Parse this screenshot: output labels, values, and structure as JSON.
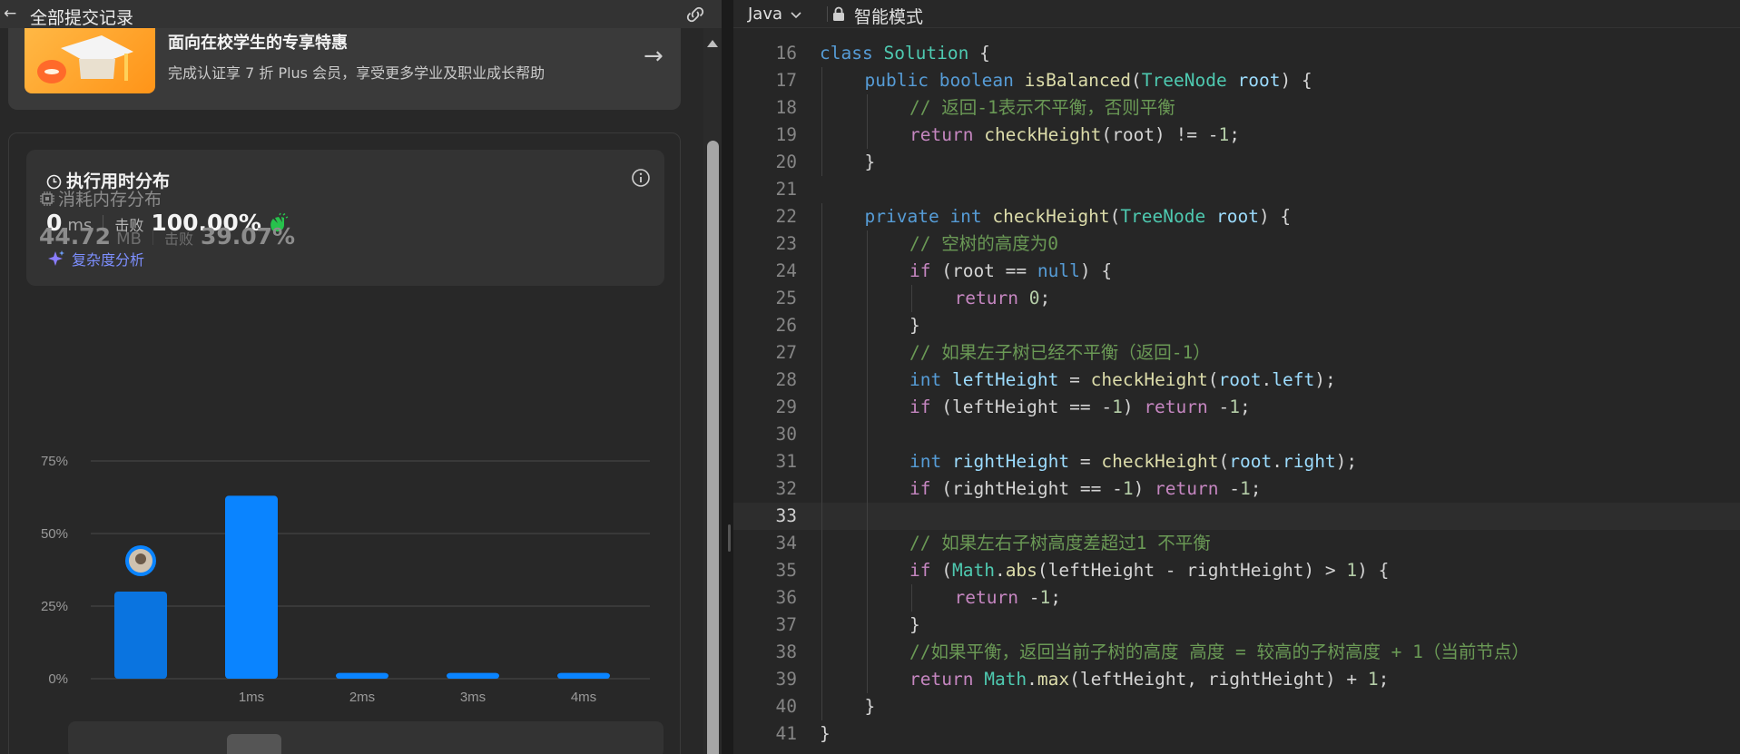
{
  "left_header": {
    "title": "全部提交记录"
  },
  "promo": {
    "title": "面向在校学生的专享特惠",
    "subtitle": "完成认证享 7 折 Plus 会员，享受更多学业及职业成长帮助"
  },
  "runtime": {
    "title": "执行用时分布",
    "value": "0",
    "unit": "ms",
    "beat_label": "击败",
    "beat_value": "100.00%",
    "complexity_link": "复杂度分析"
  },
  "memory": {
    "title": "消耗内存分布",
    "value": "44.72",
    "unit": "MB",
    "beat_label": "击败",
    "beat_value": "39.07%"
  },
  "chart_data": {
    "type": "bar",
    "categories": [
      "",
      "1ms",
      "2ms",
      "3ms",
      "4ms"
    ],
    "values": [
      30,
      63,
      2,
      2,
      2
    ],
    "ylim": [
      0,
      75
    ],
    "yticks": [
      "0%",
      "25%",
      "50%",
      "75%"
    ],
    "highlight_index": 0,
    "bar_color": "#0a84ff",
    "grid": true
  },
  "editor": {
    "language": "Java",
    "mode_label": "智能模式",
    "active_line": 33,
    "lines": [
      {
        "n": 16,
        "indent": 0,
        "tokens": [
          [
            "kw",
            "class"
          ],
          [
            "pl",
            " "
          ],
          [
            "ty",
            "Solution"
          ],
          [
            "pl",
            " {"
          ]
        ]
      },
      {
        "n": 17,
        "indent": 1,
        "tokens": [
          [
            "kw",
            "public"
          ],
          [
            "pl",
            " "
          ],
          [
            "kw",
            "boolean"
          ],
          [
            "pl",
            " "
          ],
          [
            "fn",
            "isBalanced"
          ],
          [
            "pl",
            "("
          ],
          [
            "ty",
            "TreeNode"
          ],
          [
            "pl",
            " "
          ],
          [
            "id",
            "root"
          ],
          [
            "pl",
            ") {"
          ]
        ]
      },
      {
        "n": 18,
        "indent": 2,
        "tokens": [
          [
            "cm",
            "// 返回-1表示不平衡，否则平衡"
          ]
        ]
      },
      {
        "n": 19,
        "indent": 2,
        "tokens": [
          [
            "kw2",
            "return"
          ],
          [
            "pl",
            " "
          ],
          [
            "fn",
            "checkHeight"
          ],
          [
            "pl",
            "(root) != -"
          ],
          [
            "num",
            "1"
          ],
          [
            "pl",
            ";"
          ]
        ]
      },
      {
        "n": 20,
        "indent": 1,
        "tokens": [
          [
            "pl",
            "}"
          ]
        ]
      },
      {
        "n": 21,
        "indent": 0,
        "tokens": []
      },
      {
        "n": 22,
        "indent": 1,
        "tokens": [
          [
            "kw",
            "private"
          ],
          [
            "pl",
            " "
          ],
          [
            "kw",
            "int"
          ],
          [
            "pl",
            " "
          ],
          [
            "fn",
            "checkHeight"
          ],
          [
            "pl",
            "("
          ],
          [
            "ty",
            "TreeNode"
          ],
          [
            "pl",
            " "
          ],
          [
            "id",
            "root"
          ],
          [
            "pl",
            ") {"
          ]
        ]
      },
      {
        "n": 23,
        "indent": 2,
        "tokens": [
          [
            "cm",
            "// 空树的高度为0"
          ]
        ]
      },
      {
        "n": 24,
        "indent": 2,
        "tokens": [
          [
            "kw2",
            "if"
          ],
          [
            "pl",
            " (root == "
          ],
          [
            "kw",
            "null"
          ],
          [
            "pl",
            ") {"
          ]
        ]
      },
      {
        "n": 25,
        "indent": 3,
        "tokens": [
          [
            "kw2",
            "return"
          ],
          [
            "pl",
            " "
          ],
          [
            "num",
            "0"
          ],
          [
            "pl",
            ";"
          ]
        ]
      },
      {
        "n": 26,
        "indent": 2,
        "tokens": [
          [
            "pl",
            "}"
          ]
        ]
      },
      {
        "n": 27,
        "indent": 2,
        "tokens": [
          [
            "cm",
            "// 如果左子树已经不平衡（返回-1）"
          ]
        ]
      },
      {
        "n": 28,
        "indent": 2,
        "tokens": [
          [
            "kw",
            "int"
          ],
          [
            "pl",
            " "
          ],
          [
            "id",
            "leftHeight"
          ],
          [
            "pl",
            " = "
          ],
          [
            "fn",
            "checkHeight"
          ],
          [
            "pl",
            "("
          ],
          [
            "id",
            "root"
          ],
          [
            "pl",
            "."
          ],
          [
            "id",
            "left"
          ],
          [
            "pl",
            ");"
          ]
        ]
      },
      {
        "n": 29,
        "indent": 2,
        "tokens": [
          [
            "kw2",
            "if"
          ],
          [
            "pl",
            " (leftHeight == -"
          ],
          [
            "num",
            "1"
          ],
          [
            "pl",
            ") "
          ],
          [
            "kw2",
            "return"
          ],
          [
            "pl",
            " -"
          ],
          [
            "num",
            "1"
          ],
          [
            "pl",
            ";"
          ]
        ]
      },
      {
        "n": 30,
        "indent": 0,
        "tokens": []
      },
      {
        "n": 31,
        "indent": 2,
        "tokens": [
          [
            "kw",
            "int"
          ],
          [
            "pl",
            " "
          ],
          [
            "id",
            "rightHeight"
          ],
          [
            "pl",
            " = "
          ],
          [
            "fn",
            "checkHeight"
          ],
          [
            "pl",
            "("
          ],
          [
            "id",
            "root"
          ],
          [
            "pl",
            "."
          ],
          [
            "id",
            "right"
          ],
          [
            "pl",
            ");"
          ]
        ]
      },
      {
        "n": 32,
        "indent": 2,
        "tokens": [
          [
            "kw2",
            "if"
          ],
          [
            "pl",
            " (rightHeight == -"
          ],
          [
            "num",
            "1"
          ],
          [
            "pl",
            ") "
          ],
          [
            "kw2",
            "return"
          ],
          [
            "pl",
            " -"
          ],
          [
            "num",
            "1"
          ],
          [
            "pl",
            ";"
          ]
        ]
      },
      {
        "n": 33,
        "indent": 0,
        "tokens": []
      },
      {
        "n": 34,
        "indent": 2,
        "tokens": [
          [
            "cm",
            "// 如果左右子树高度差超过1 不平衡"
          ]
        ]
      },
      {
        "n": 35,
        "indent": 2,
        "tokens": [
          [
            "kw2",
            "if"
          ],
          [
            "pl",
            " ("
          ],
          [
            "ty",
            "Math"
          ],
          [
            "pl",
            "."
          ],
          [
            "fn",
            "abs"
          ],
          [
            "pl",
            "(leftHeight - rightHeight) > "
          ],
          [
            "num",
            "1"
          ],
          [
            "pl",
            ") {"
          ]
        ]
      },
      {
        "n": 36,
        "indent": 3,
        "tokens": [
          [
            "kw2",
            "return"
          ],
          [
            "pl",
            " -"
          ],
          [
            "num",
            "1"
          ],
          [
            "pl",
            ";"
          ]
        ]
      },
      {
        "n": 37,
        "indent": 2,
        "tokens": [
          [
            "pl",
            "}"
          ]
        ]
      },
      {
        "n": 38,
        "indent": 2,
        "tokens": [
          [
            "cm",
            "//如果平衡，返回当前子树的高度 高度 = 较高的子树高度 + 1（当前节点）"
          ]
        ]
      },
      {
        "n": 39,
        "indent": 2,
        "tokens": [
          [
            "kw2",
            "return"
          ],
          [
            "pl",
            " "
          ],
          [
            "ty",
            "Math"
          ],
          [
            "pl",
            "."
          ],
          [
            "fn",
            "max"
          ],
          [
            "pl",
            "(leftHeight, rightHeight) + "
          ],
          [
            "num",
            "1"
          ],
          [
            "pl",
            ";"
          ]
        ]
      },
      {
        "n": 40,
        "indent": 1,
        "tokens": [
          [
            "pl",
            "}"
          ]
        ]
      },
      {
        "n": 41,
        "indent": 0,
        "tokens": [
          [
            "pl",
            "}"
          ]
        ]
      }
    ]
  }
}
